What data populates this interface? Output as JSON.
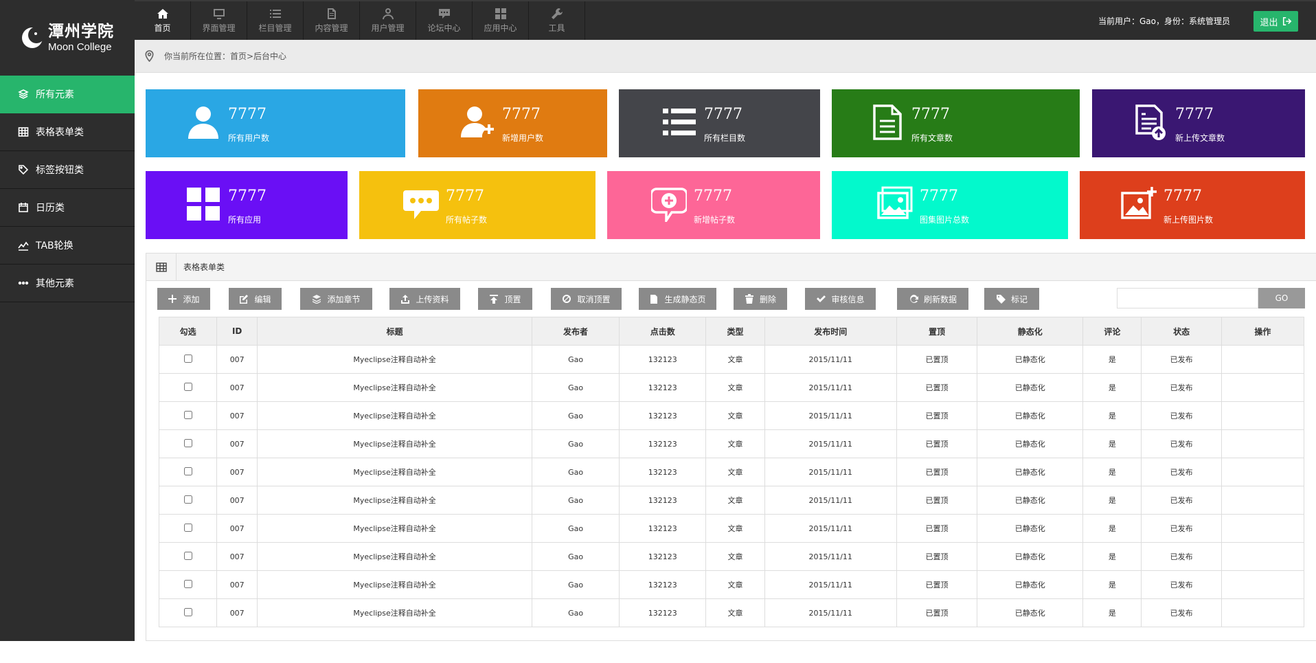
{
  "logo": {
    "cn": "潭州学院",
    "en": "Moon College"
  },
  "sidebar": {
    "items": [
      {
        "label": "所有元素",
        "icon": "layers-icon",
        "active": true
      },
      {
        "label": "表格表单类",
        "icon": "table-icon"
      },
      {
        "label": "标签按钮类",
        "icon": "tag-icon"
      },
      {
        "label": "日历类",
        "icon": "calendar-icon"
      },
      {
        "label": "TAB轮换",
        "icon": "chart-icon"
      },
      {
        "label": "其他元素",
        "icon": "more-icon"
      }
    ]
  },
  "topnav": {
    "items": [
      {
        "label": "首页",
        "icon": "home-icon",
        "active": true
      },
      {
        "label": "界面管理",
        "icon": "monitor-icon"
      },
      {
        "label": "栏目管理",
        "icon": "list-icon"
      },
      {
        "label": "内容管理",
        "icon": "document-icon"
      },
      {
        "label": "用户管理",
        "icon": "user-icon"
      },
      {
        "label": "论坛中心",
        "icon": "chat-icon"
      },
      {
        "label": "应用中心",
        "icon": "grid-icon"
      },
      {
        "label": "工具",
        "icon": "wrench-icon"
      }
    ],
    "user_info": "当前用户：Gao，身份：系统管理员",
    "logout_label": "退出"
  },
  "breadcrumb": "你当前所在位置：首页>后台中心",
  "cards": [
    {
      "value": "7777",
      "label": "所有用户数",
      "color": "#2aa7e4",
      "icon": "user-icon"
    },
    {
      "value": "7777",
      "label": "新增用户数",
      "color": "#e07b11",
      "icon": "user-add-icon"
    },
    {
      "value": "7777",
      "label": "所有栏目数",
      "color": "#44454a",
      "icon": "list-icon"
    },
    {
      "value": "7777",
      "label": "所有文章数",
      "color": "#277c17",
      "icon": "document-icon"
    },
    {
      "value": "7777",
      "label": "新上传文章数",
      "color": "#3a1772",
      "icon": "document-upload-icon"
    },
    {
      "value": "7777",
      "label": "所有应用",
      "color": "#6a0ff5",
      "icon": "apps-icon"
    },
    {
      "value": "7777",
      "label": "所有帖子数",
      "color": "#f5c10e",
      "icon": "chat-bubble-icon"
    },
    {
      "value": "7777",
      "label": "新增帖子数",
      "color": "#fd6697",
      "icon": "chat-add-icon"
    },
    {
      "value": "7777",
      "label": "图集图片总数",
      "color": "#03f9cc",
      "icon": "image-icon"
    },
    {
      "value": "7777",
      "label": "新上传图片数",
      "color": "#dd3f1c",
      "icon": "image-add-icon"
    }
  ],
  "panel": {
    "title": "表格表单类"
  },
  "toolbar": {
    "buttons": [
      {
        "label": "添加",
        "icon": "plus-icon"
      },
      {
        "label": "编辑",
        "icon": "edit-icon"
      },
      {
        "label": "添加章节",
        "icon": "layers-icon"
      },
      {
        "label": "上传资料",
        "icon": "upload-icon"
      },
      {
        "label": "顶置",
        "icon": "pin-top-icon"
      },
      {
        "label": "取消顶置",
        "icon": "cancel-icon"
      },
      {
        "label": "生成静态页",
        "icon": "file-icon"
      },
      {
        "label": "删除",
        "icon": "trash-icon"
      },
      {
        "label": "审核信息",
        "icon": "check-icon"
      },
      {
        "label": "刷新数据",
        "icon": "refresh-icon"
      },
      {
        "label": "标记",
        "icon": "tag-icon"
      }
    ],
    "search_placeholder": "",
    "go_label": "GO"
  },
  "table": {
    "headers": [
      "勾选",
      "ID",
      "标题",
      "发布者",
      "点击数",
      "类型",
      "发布时间",
      "置顶",
      "静态化",
      "评论",
      "状态",
      "操作"
    ],
    "rows": [
      [
        "007",
        "Myeclipse注释自动补全",
        "Gao",
        "132123",
        "文章",
        "2015/11/11",
        "已置顶",
        "已静态化",
        "是",
        "已发布",
        ""
      ],
      [
        "007",
        "Myeclipse注释自动补全",
        "Gao",
        "132123",
        "文章",
        "2015/11/11",
        "已置顶",
        "已静态化",
        "是",
        "已发布",
        ""
      ],
      [
        "007",
        "Myeclipse注释自动补全",
        "Gao",
        "132123",
        "文章",
        "2015/11/11",
        "已置顶",
        "已静态化",
        "是",
        "已发布",
        ""
      ],
      [
        "007",
        "Myeclipse注释自动补全",
        "Gao",
        "132123",
        "文章",
        "2015/11/11",
        "已置顶",
        "已静态化",
        "是",
        "已发布",
        ""
      ],
      [
        "007",
        "Myeclipse注释自动补全",
        "Gao",
        "132123",
        "文章",
        "2015/11/11",
        "已置顶",
        "已静态化",
        "是",
        "已发布",
        ""
      ],
      [
        "007",
        "Myeclipse注释自动补全",
        "Gao",
        "132123",
        "文章",
        "2015/11/11",
        "已置顶",
        "已静态化",
        "是",
        "已发布",
        ""
      ],
      [
        "007",
        "Myeclipse注释自动补全",
        "Gao",
        "132123",
        "文章",
        "2015/11/11",
        "已置顶",
        "已静态化",
        "是",
        "已发布",
        ""
      ],
      [
        "007",
        "Myeclipse注释自动补全",
        "Gao",
        "132123",
        "文章",
        "2015/11/11",
        "已置顶",
        "已静态化",
        "是",
        "已发布",
        ""
      ],
      [
        "007",
        "Myeclipse注释自动补全",
        "Gao",
        "132123",
        "文章",
        "2015/11/11",
        "已置顶",
        "已静态化",
        "是",
        "已发布",
        ""
      ],
      [
        "007",
        "Myeclipse注释自动补全",
        "Gao",
        "132123",
        "文章",
        "2015/11/11",
        "已置顶",
        "已静态化",
        "是",
        "已发布",
        ""
      ]
    ]
  }
}
